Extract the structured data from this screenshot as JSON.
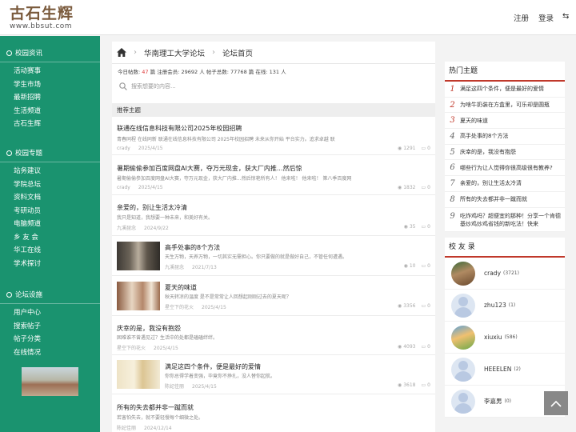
{
  "header": {
    "logo_title": "古石生辉",
    "logo_url": "www.bbsut.com",
    "register": "注册",
    "login": "登录",
    "menu_icon": "⇆"
  },
  "sidebar": {
    "sections": [
      {
        "title": "校园资讯",
        "items": [
          "活动赛事",
          "学生市场",
          "最新招聘",
          "生活频道",
          "古石生辉"
        ]
      },
      {
        "title": "校园专题",
        "items": [
          "站务建议",
          "学院总坛",
          "资料文档",
          "考研动员",
          "电脑频道",
          "乡 友 会",
          "华工在线",
          "学术探讨"
        ]
      },
      {
        "title": "论坛设施",
        "items": [
          "用户中心",
          "搜索帖子",
          "帖子分类",
          "在线情况"
        ]
      }
    ]
  },
  "breadcrumb": {
    "site": "华南理工大学论坛",
    "page": "论坛首页"
  },
  "stats": {
    "today_label": "今日帖数:",
    "today": "47",
    "rest": "篇 注册会员: 29692 人 帖子总数: 77768 篇 在线: 131 人"
  },
  "search": {
    "placeholder": "搜索想要的内容..."
  },
  "recommend_label": "推荐主题",
  "posts": [
    {
      "title": "联通在线信息科技有限公司2025年校园招聘",
      "desc": "青春同程 在线同新 联通在线信息科技有限公司 2025年校园招聘 未来从你开始 平台实力。追求卓越 联",
      "author": "crady",
      "date": "2025/4/15",
      "views": "1291",
      "replies": "0"
    },
    {
      "title": "暑期偷偷参加百度网盘AI大赛，夺万元现金，获大厂内推...然后惊",
      "desc": "暑期偷偷参加百度网盘AI大赛，夺万元现金，获大厂内推...然后惊艳所有人！ 他来啦！ 他来啦！ 第八季百度网",
      "author": "crady",
      "date": "2025/4/15",
      "views": "1832",
      "replies": "0"
    },
    {
      "title": "亲爱的，别让生活太冷清",
      "desc": "我只是知道，我想要一种未来，和美好有关。",
      "author": "九溪琵念",
      "date": "2024/9/22",
      "views": "35",
      "replies": "0"
    },
    {
      "title": "高手处事的8个方法",
      "desc": "天生万物，天养万物，一切其实无需担心。你只要做的就是做好自己，不管任何遭遇。",
      "author": "九溪琵念",
      "date": "2021/7/13",
      "views": "10",
      "replies": "0"
    },
    {
      "title": "夏天的味道",
      "desc": "秋天转凉的温度 是不是常常让人回想起刚刚过去的夏天呢？",
      "author": "星空下的花火",
      "date": "2025/4/15",
      "views": "3356",
      "replies": "0"
    },
    {
      "title": "庆幸的是，我没有抱怨",
      "desc": "困难谁不曾遇见过？生活中的处都是磕磕绊绊。",
      "author": "星空下的花火",
      "date": "2025/4/15",
      "views": "4093",
      "replies": "0"
    },
    {
      "title": "满足这四个条件，便是最好的爱情",
      "desc": "你你总得学着变强，毕竟你不挣扎，没人替你起航。",
      "author": "陈妃佳丽",
      "date": "2025/4/15",
      "views": "3618",
      "replies": "0"
    },
    {
      "title": "所有的失去都并非一蹴而就",
      "desc": "若害怕失去，就不要轻慢每个细微之处。",
      "author": "陈妃佳丽",
      "date": "2024/12/14",
      "views": "",
      "replies": ""
    }
  ],
  "hot": {
    "title": "热门主题",
    "items": [
      "满足这四个条件，便是最好的爱情",
      "为啥牛奶装在方盒里，可乐却是圆瓶",
      "夏天的味道",
      "高手处事的8个方法",
      "庆幸的是，我没有抱怨",
      "哪些行为让人觉得你很高级很有教养?",
      "亲爱的，别让生活太冷清",
      "所有的失去都并非一蹴而就",
      "吃炸鸡吗？超便宜的那种！分享一个肯德基炒鸡炒鸡省钱的新吃法！快来"
    ]
  },
  "users": {
    "title": "校 友 录",
    "items": [
      {
        "name": "crady",
        "count": "(3721)"
      },
      {
        "name": "zhu123",
        "count": "(1)"
      },
      {
        "name": "xiuxiu",
        "count": "(586)"
      },
      {
        "name": "HEEELEN",
        "count": "(2)"
      },
      {
        "name": "李嘉男",
        "count": "(0)"
      }
    ]
  },
  "colors": {
    "sidebar": "#1a936f",
    "accent": "#c0392b",
    "stat_red": "#dd3333"
  }
}
